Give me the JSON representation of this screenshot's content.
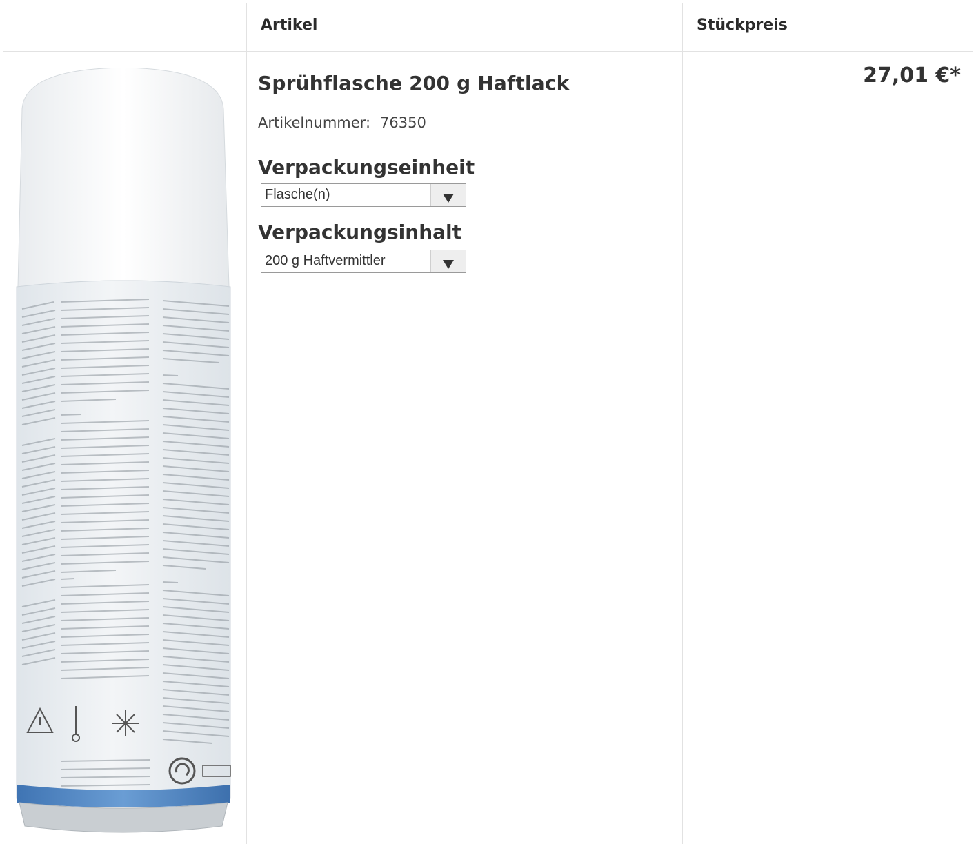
{
  "header": {
    "col_image": "",
    "col_article": "Artikel",
    "col_price": "Stückpreis"
  },
  "product": {
    "name": "Sprühflasche 200 g Haftlack",
    "article_number_label": "Artikelnummer:",
    "article_number": "76350",
    "price": "27,01 €*",
    "packaging_unit": {
      "label": "Verpackungseinheit",
      "selected": "Flasche(n)"
    },
    "packaging_content": {
      "label": "Verpackungsinhalt",
      "selected": "200 g Haftvermittler"
    }
  },
  "colors": {
    "can_body": "#eef1f4",
    "can_band": "#4f86c4",
    "border": "#e2e2e2"
  }
}
